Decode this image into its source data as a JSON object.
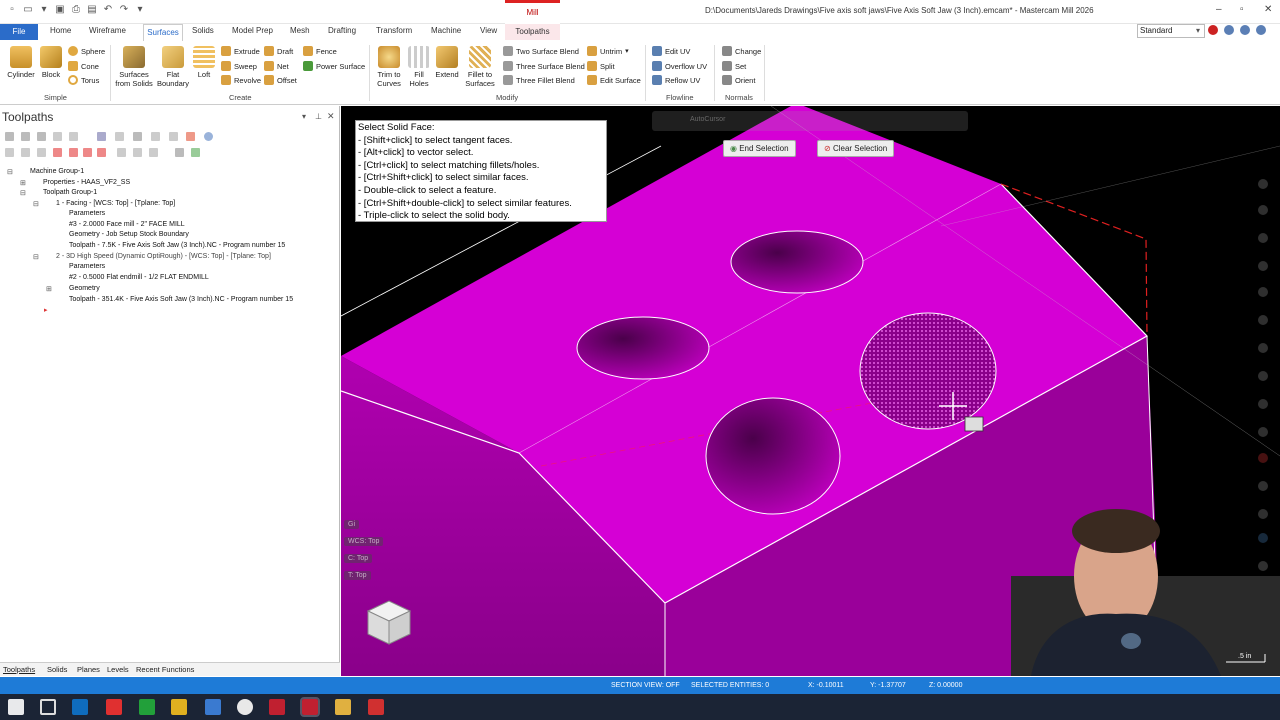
{
  "title_bar": {
    "path": "D:\\Documents\\Jareds Drawings\\Five axis soft jaws\\Five Axis Soft Jaw (3 Inch).emcam* - Mastercam Mill 2026",
    "context_tab": "Mill"
  },
  "menu": {
    "file": "File",
    "tabs": [
      "Home",
      "Wireframe",
      "Surfaces",
      "Solids",
      "Model Prep",
      "Mesh",
      "Drafting",
      "Transform",
      "Machine",
      "View",
      "Toolpaths"
    ],
    "workspace": "Standard"
  },
  "ribbon": {
    "simple": {
      "label": "Simple",
      "cylinder": "Cylinder",
      "block": "Block",
      "sphere": "Sphere",
      "cone": "Cone",
      "torus": "Torus"
    },
    "create": {
      "label": "Create",
      "surfaces_from_solids_1": "Surfaces",
      "surfaces_from_solids_2": "from Solids",
      "flat_boundary_1": "Flat",
      "flat_boundary_2": "Boundary",
      "loft": "Loft",
      "extrude": "Extrude",
      "sweep": "Sweep",
      "revolve": "Revolve",
      "draft": "Draft",
      "net": "Net",
      "offset": "Offset",
      "fence": "Fence",
      "power_surface": "Power Surface"
    },
    "modify": {
      "label": "Modify",
      "trim_to_curves_1": "Trim to",
      "trim_to_curves_2": "Curves",
      "fill_holes_1": "Fill",
      "fill_holes_2": "Holes",
      "extend": "Extend",
      "fillet_to_surfaces_1": "Fillet to",
      "fillet_to_surfaces_2": "Surfaces",
      "two_surface_blend": "Two Surface Blend",
      "three_surface_blend": "Three Surface Blend",
      "three_fillet_blend": "Three Fillet Blend",
      "untrim": "Untrim",
      "split": "Split",
      "edit_surface": "Edit Surface"
    },
    "flowline": {
      "label": "Flowline",
      "edit_uv": "Edit UV",
      "overflow_uv": "Overflow UV",
      "reflow_uv": "Reflow UV"
    },
    "normals": {
      "label": "Normals",
      "change": "Change",
      "set": "Set",
      "orient": "Orient"
    }
  },
  "toolpaths_panel": {
    "title": "Toolpaths",
    "tree": [
      "Machine Group-1",
      "Properties - HAAS_VF2_SS",
      "Toolpath Group-1",
      "1 - Facing - [WCS: Top] - [Tplane: Top]",
      "Parameters",
      "#3 - 2.0000 Face mill - 2\" FACE MILL",
      "Geometry - Job Setup Stock Boundary",
      "Toolpath - 7.5K - Five Axis Soft Jaw (3 Inch).NC - Program number 15",
      "2 - 3D High Speed (Dynamic OptiRough) - [WCS: Top] - [Tplane: Top]",
      "Parameters",
      "#2 - 0.5000 Flat endmill - 1/2 FLAT ENDMILL",
      "Geometry",
      "Toolpath - 351.4K - Five Axis Soft Jaw (3 Inch).NC - Program number 15"
    ],
    "bottom_tabs": [
      "Toolpaths",
      "Solids",
      "Planes",
      "Levels",
      "Recent Functions"
    ]
  },
  "viewport": {
    "hint_title": "Select Solid Face:",
    "hint_lines": [
      "- [Shift+click] to select tangent faces.",
      "- [Alt+click] to vector select.",
      "- [Ctrl+click] to select matching fillets/holes.",
      "- [Ctrl+Shift+click] to select similar faces.",
      "- Double-click to select a feature.",
      "- [Ctrl+Shift+double-click] to select similar features.",
      "- Triple-click to select the solid body."
    ],
    "end_selection": "End Selection",
    "clear_selection": "Clear Selection",
    "autocursor": "AutoCursor",
    "gi": "Gi",
    "wcs": "WCS: Top",
    "c": "C: Top",
    "t": "T: Top",
    "scale": ".5 in",
    "solid_color": "#d500d5"
  },
  "status_bar": {
    "section_view": "SECTION VIEW: OFF",
    "selected_entities": "SELECTED ENTITIES: 0",
    "x": "X:  -0.10011",
    "y": "Y:  -1.37707",
    "z": "Z:  0.00000"
  }
}
